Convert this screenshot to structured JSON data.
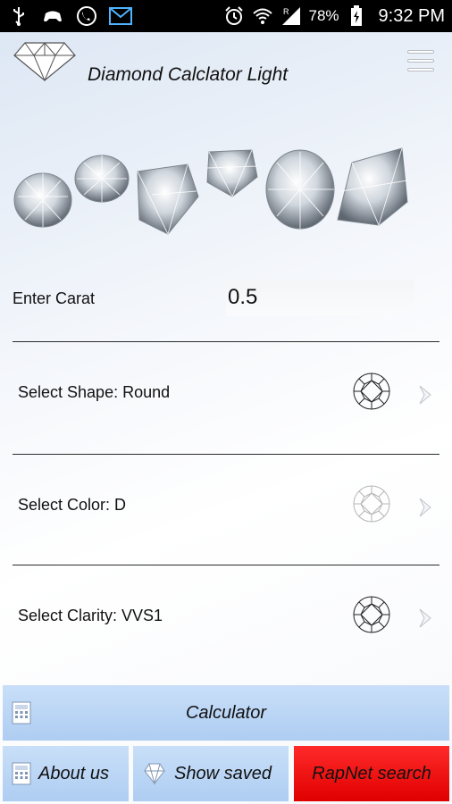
{
  "status_bar": {
    "battery": "78%",
    "time": "9:32 PM",
    "icons": [
      "usb-icon",
      "gamepad-icon",
      "phone-icon",
      "mail-icon",
      "alarm-icon",
      "wifi-icon",
      "signal-icon",
      "battery-icon"
    ]
  },
  "header": {
    "title": "Diamond Calclator Light",
    "logo": "diamond-logo-icon",
    "menu": "menu-icon"
  },
  "carat": {
    "label": "Enter Carat",
    "value": "0.5"
  },
  "selects": [
    {
      "label": "Select Shape: Round",
      "icon": "round-diamond-icon",
      "icon_color": "#222222"
    },
    {
      "label": "Select Color: D",
      "icon": "round-diamond-icon",
      "icon_color": "#b5b5b5"
    },
    {
      "label": "Select Clarity: VVS1",
      "icon": "round-diamond-icon",
      "icon_color": "#222222"
    }
  ],
  "buttons": {
    "calculator": "Calculator",
    "about": "About us",
    "saved": "Show saved",
    "rapnet": "RapNet search"
  },
  "colors": {
    "button_blue": "#b9d5f5",
    "button_red": "#f01010",
    "status_bar": "#000000"
  }
}
